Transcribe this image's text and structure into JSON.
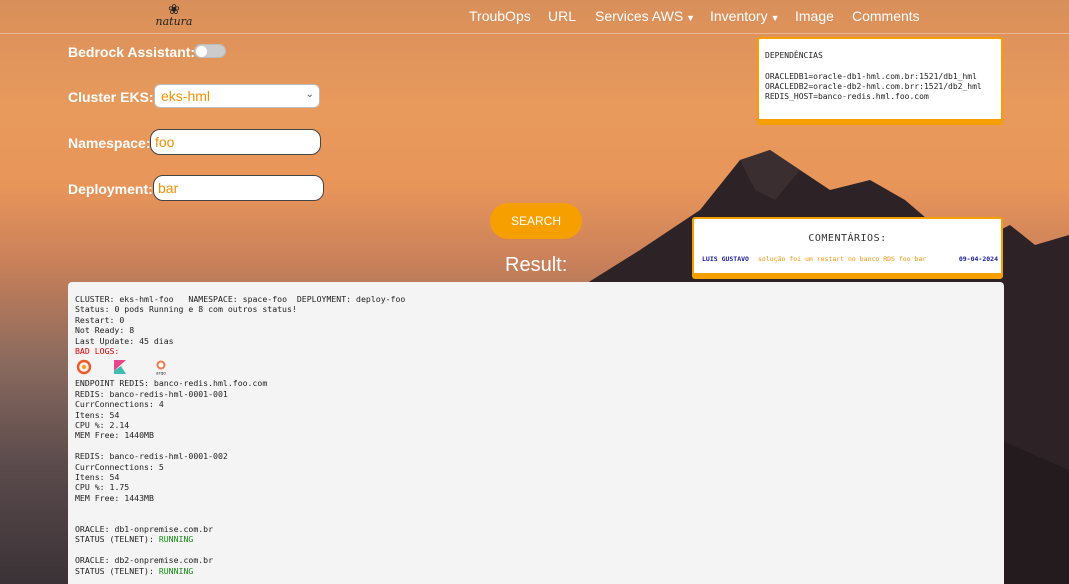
{
  "nav": {
    "logo_text": "natura",
    "items": [
      {
        "label": "TroubOps",
        "dropdown": false
      },
      {
        "label": "URL",
        "dropdown": false
      },
      {
        "label": "Services AWS",
        "dropdown": true
      },
      {
        "label": "Inventory",
        "dropdown": true
      },
      {
        "label": "Image",
        "dropdown": false
      },
      {
        "label": "Comments",
        "dropdown": false
      }
    ]
  },
  "form": {
    "bedrock_label": "Bedrock Assistant:",
    "bedrock_on": false,
    "cluster_label": "Cluster EKS:",
    "cluster_value": "eks-hml",
    "namespace_label": "Namespace:",
    "namespace_value": "foo",
    "deployment_label": "Deployment:",
    "deployment_value": "bar",
    "search_label": "SEARCH"
  },
  "result_title": "Result:",
  "dependencies": {
    "title": "DEPENDÊNCIAS",
    "lines": [
      "ORACLEDB1=oracle-db1-hml.com.br:1521/db1_hml",
      "ORACLEDB2=oracle-db2-hml.com.brr:1521/db2_hml",
      "REDIS_HOST=banco-redis.hml.foo.com"
    ]
  },
  "comments": {
    "title": "COMENTÁRIOS:",
    "entries": [
      {
        "user": "LUIS GUSTAVO",
        "message": "solução foi um restart no banco RDS foo bar",
        "date": "09-04-2024"
      }
    ]
  },
  "result": {
    "cluster_label": "CLUSTER:",
    "cluster": "eks-hml-foo",
    "namespace_label": "NAMESPACE:",
    "namespace": "space-foo",
    "deployment_label": "DEPLOYMENT:",
    "deployment": "deploy-foo",
    "status_label": "Status:",
    "status": "0 pods Running e 8 com outros status!",
    "restart_label": "Restart:",
    "restart": "0",
    "not_ready_label": "Not Ready:",
    "not_ready": "8",
    "last_update_label": "Last Update:",
    "last_update": "45 dias",
    "bad_logs_label": "BAD LOGS:",
    "log_icons": [
      "grafana-icon",
      "kibana-icon",
      "argo-icon"
    ],
    "argo_text": "argo",
    "endpoint_label": "ENDPOINT REDIS:",
    "endpoint": "banco-redis.hml.foo.com",
    "redis": [
      {
        "redis_label": "REDIS:",
        "name": "banco-redis-hml-0001-001",
        "conn_label": "CurrConnections:",
        "conn": "4",
        "items_label": "Itens:",
        "items": "54",
        "cpu_label": "CPU %:",
        "cpu": "2.14",
        "mem_label": "MEM Free:",
        "mem": "1440MB"
      },
      {
        "redis_label": "REDIS:",
        "name": "banco-redis-hml-0001-002",
        "conn_label": "CurrConnections:",
        "conn": "5",
        "items_label": "Itens:",
        "items": "54",
        "cpu_label": "CPU %:",
        "cpu": "1.75",
        "mem_label": "MEM Free:",
        "mem": "1443MB"
      }
    ],
    "oracle": [
      {
        "oracle_label": "ORACLE:",
        "host": "db1-onpremise.com.br",
        "status_label": "STATUS (TELNET):",
        "status": "RUNNING"
      },
      {
        "oracle_label": "ORACLE:",
        "host": "db2-onpremise.com.br",
        "status_label": "STATUS (TELNET):",
        "status": "RUNNING"
      }
    ]
  },
  "colors": {
    "accent": "#f5a000",
    "field_text": "#f29100",
    "running": "#1a8a1a",
    "bad_logs": "#e00000"
  }
}
